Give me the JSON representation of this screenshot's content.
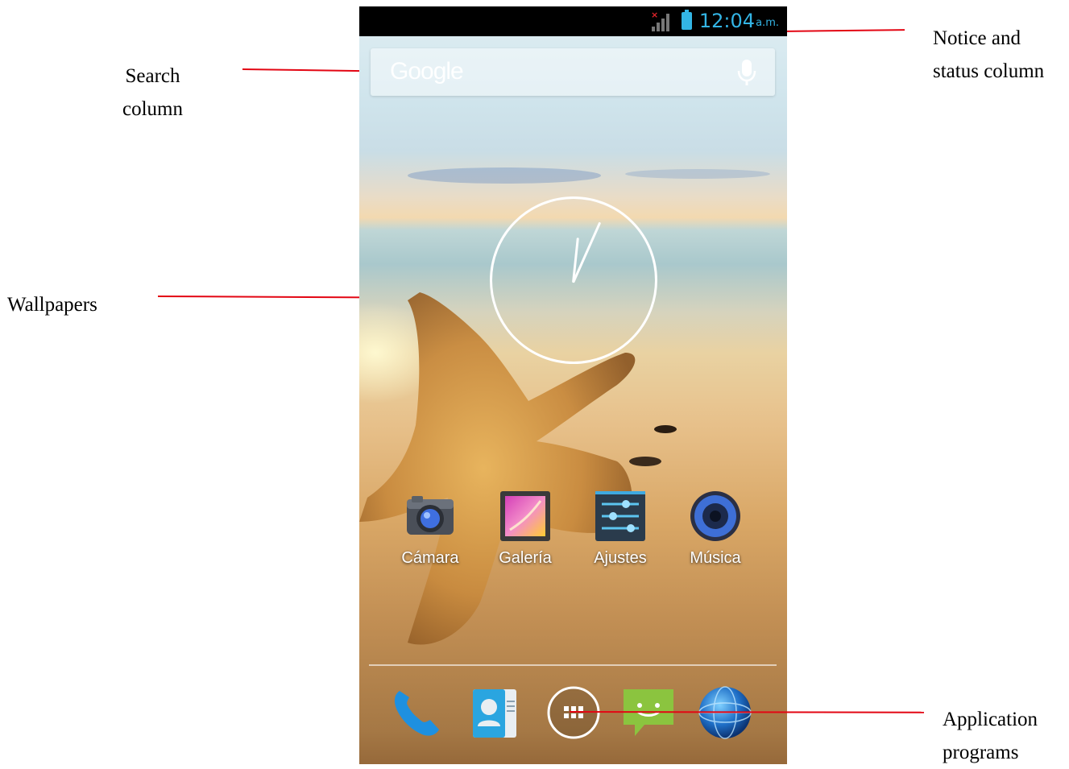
{
  "annotations": {
    "search_column": "Search\ncolumn",
    "wallpapers": "Wallpapers",
    "notice_status": "Notice and\nstatus column",
    "application_programs": "Application\nprograms"
  },
  "status_bar": {
    "time": "12:04",
    "ampm": "a.m.",
    "icons": [
      "no-signal-icon",
      "battery-icon"
    ],
    "accent_color": "#33b5e5"
  },
  "search": {
    "placeholder": "Google",
    "voice_icon": "microphone-icon"
  },
  "widgets": {
    "analog_clock": {
      "icon": "analog-clock"
    }
  },
  "apps": [
    {
      "label": "Cámara",
      "icon": "camera-icon"
    },
    {
      "label": "Galería",
      "icon": "gallery-icon"
    },
    {
      "label": "Ajustes",
      "icon": "settings-icon"
    },
    {
      "label": "Música",
      "icon": "music-icon"
    }
  ],
  "dock": [
    {
      "name": "phone",
      "icon": "phone-icon"
    },
    {
      "name": "contacts",
      "icon": "contacts-icon"
    },
    {
      "name": "all-apps",
      "icon": "app-drawer-icon"
    },
    {
      "name": "messaging",
      "icon": "messaging-icon"
    },
    {
      "name": "browser",
      "icon": "globe-icon"
    }
  ],
  "colors": {
    "callout_line": "#e30613",
    "status_bar_bg": "#000000"
  }
}
